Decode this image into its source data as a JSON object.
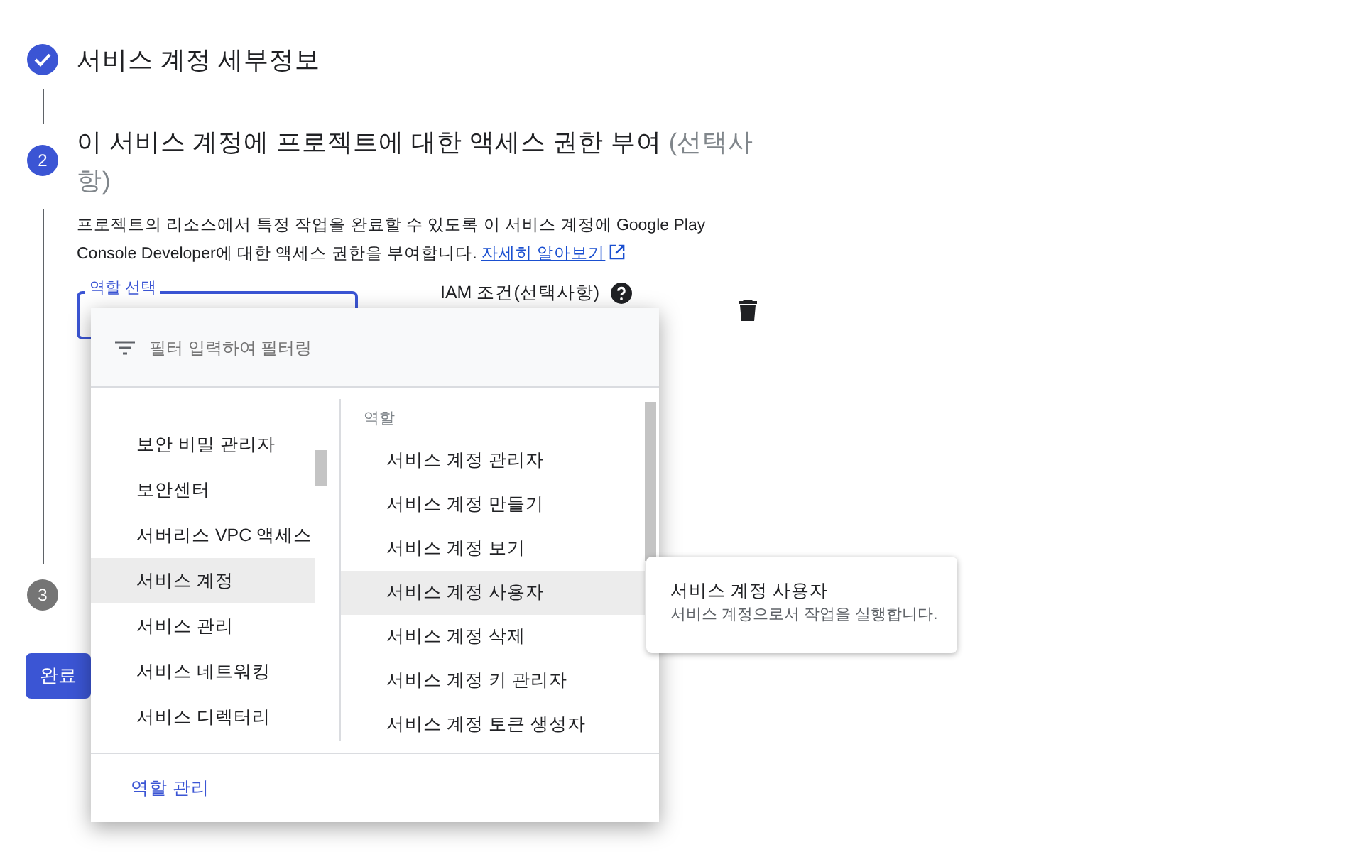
{
  "steps": [
    {
      "kind": "done",
      "title": "서비스 계정 세부정보"
    },
    {
      "kind": "active",
      "number": "2",
      "title": "이 서비스 계정에 프로젝트에 대한 액세스 권한 부여",
      "title_suffix": "(선택사항)"
    },
    {
      "kind": "pending",
      "number": "3"
    }
  ],
  "description": "프로젝트의 리소스에서 특정 작업을 완료할 수 있도록 이 서비스 계정에 Google Play Console Developer에 대한 액세스 권한을 부여합니다.",
  "learn_more_link": "자세히 알아보기",
  "role_field": {
    "label": "역할 선택"
  },
  "iam_condition_label": "IAM 조건(선택사항)",
  "done_button": "완료",
  "menu": {
    "filter_placeholder": "필터 입력하여 필터링",
    "categories": [
      {
        "label": "보안 비밀 관리자",
        "selected": false
      },
      {
        "label": "보안센터",
        "selected": false
      },
      {
        "label": "서버리스 VPC 액세스",
        "selected": false
      },
      {
        "label": "서비스 계정",
        "selected": true
      },
      {
        "label": "서비스 관리",
        "selected": false
      },
      {
        "label": "서비스 네트워킹",
        "selected": false
      },
      {
        "label": "서비스 디렉터리",
        "selected": false
      }
    ],
    "roles_header": "역할",
    "roles": [
      {
        "label": "서비스 계정 관리자",
        "selected": false
      },
      {
        "label": "서비스 계정 만들기",
        "selected": false
      },
      {
        "label": "서비스 계정 보기",
        "selected": false
      },
      {
        "label": "서비스 계정 사용자",
        "selected": true
      },
      {
        "label": "서비스 계정 삭제",
        "selected": false
      },
      {
        "label": "서비스 계정 키 관리자",
        "selected": false
      },
      {
        "label": "서비스 계정 토큰 생성자",
        "selected": false
      }
    ],
    "footer_link": "역할 관리"
  },
  "tooltip": {
    "title": "서비스 계정 사용자",
    "text": "서비스 계정으로서 작업을 실행합니다."
  }
}
